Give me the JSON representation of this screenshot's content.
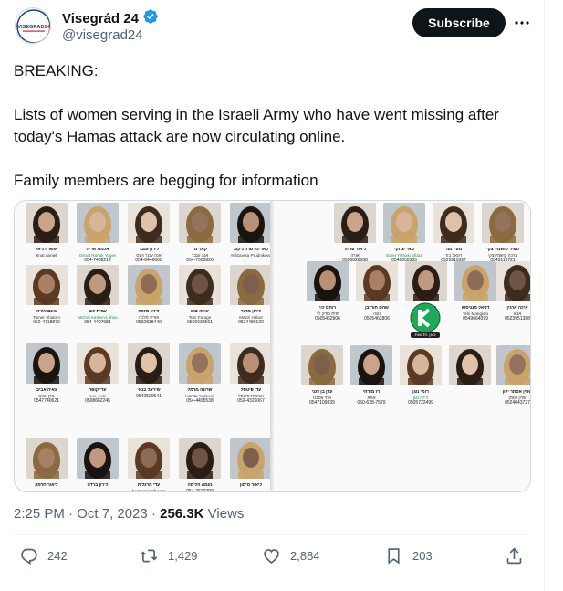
{
  "author": {
    "name": "Visegrád 24",
    "handle": "@visegrad24",
    "avatar_text": "VISEGRAD24"
  },
  "subscribe_label": "Subscribe",
  "tweet": {
    "lines": [
      "BREAKING:",
      "Lists of women serving in the Israeli Army who have went missing after today's Hamas attack are now circulating online.",
      "Family members are begging for information"
    ]
  },
  "media": {
    "watermark": "כאן חדשות",
    "left_page": [
      {
        "name": "אושר דניאל",
        "sub": "rinat daniel",
        "phone": ""
      },
      {
        "name": "אלמוג אריה",
        "sub": "Osnat Rahak Yogev",
        "phone": "054-7488212"
      },
      {
        "name": "לירון ענבר",
        "sub": "אנה עננר ווינס",
        "phone": "054-6446008"
      },
      {
        "name": "קארינה",
        "sub": "אנה ענבר",
        "phone": "054-7565820"
      },
      {
        "name": "קארינה פרודניקוב",
        "sub": "Yelizaveta Prudnikova",
        "phone": ""
      },
      {
        "name": "נועם אליה",
        "sub": "Tomer Shalom",
        "phone": "052-4718870"
      },
      {
        "name": "עמית לוב",
        "sub": "Michal Karben-Lahav",
        "phone": "054-4407981"
      },
      {
        "name": "לירון מלכה",
        "sub": "אורלי מלכה",
        "phone": "0532838440"
      },
      {
        "name": "נועה פרג'",
        "sub": "Tom Farage",
        "phone": "0506633561"
      },
      {
        "name": "לירון מאור",
        "sub": "Mazzi Habut",
        "phone": "0524480122"
      },
      {
        "name": "גאיה אביב",
        "sub": "גורן אביב",
        "phone": "0547740621"
      },
      {
        "name": "עדי קופר",
        "sub": "mor_kobi",
        "phone": "0508662245"
      },
      {
        "name": "שיראל בנאי",
        "sub": "",
        "phone": "0542500541"
      },
      {
        "name": "שרונה מרמל",
        "sub": "Hanita Yudevsil",
        "phone": "054-4495538"
      },
      {
        "name": "עדן פיטסל",
        "sub": "אביבית פיטסל",
        "phone": "052-4326067"
      },
      {
        "name": "ליאור חרמון",
        "sub": "",
        "phone": ""
      },
      {
        "name": "לירון ברדה",
        "sub": "",
        "phone": ""
      },
      {
        "name": "עדי מרגלית",
        "sub": "harmonicsoft.corp",
        "phone": ""
      },
      {
        "name": "נעמה הלימה",
        "sub": "",
        "phone": "054-7600200"
      },
      {
        "name": "ליאור מימון",
        "sub": "",
        "phone": ""
      }
    ],
    "right_page": [
      {
        "name": "ליאור פרחר",
        "sub": "אורה",
        "phone": "0558826588"
      },
      {
        "name": "מאי יצחקי",
        "sub": "Eden Yizhaki Elbaz",
        "phone": "0549850385"
      },
      {
        "name": "מעין מור",
        "sub": "רונאל בור",
        "phone": "0525911897"
      },
      {
        "name": "ספיר קושמירצקי",
        "sub": "ברכה קושמירצקי",
        "phone": "0543118721"
      },
      {
        "name": "רותם לוי",
        "sub": "יפית בודק לוי",
        "phone": "0505462906"
      },
      {
        "name": "שחם חורזבן",
        "sub": "נוגה",
        "phone": "0505462806"
      },
      {
        "name": "ליאור רחל",
        "sub": "Hofit Rahal",
        "phone": "0542335626"
      },
      {
        "name": "דניאל מנגיסטו",
        "sub": "Tehi Mangisto",
        "phone": "0549664099"
      },
      {
        "name": "אילה ארגין",
        "sub": "אבא",
        "phone": "0523951388"
      },
      {
        "name": "עדן בן דגני",
        "sub": "אתי אסבנו",
        "phone": "0547109839"
      },
      {
        "name": "רז מזרחי",
        "sub": "אמא",
        "phone": "050-628-7579"
      },
      {
        "name": "רומי נוגן",
        "sub": "הילה נוגן",
        "phone": "0505722499"
      },
      {
        "name": "",
        "sub": "",
        "phone": ""
      },
      {
        "name": "שטין אסתר ילון",
        "sub": "שרון ויסמן",
        "phone": "0524043727"
      }
    ]
  },
  "meta": {
    "time": "2:25 PM",
    "date": "Oct 7, 2023",
    "views_count": "256.3K",
    "views_label": "Views"
  },
  "actions": {
    "replies": "242",
    "reposts": "1,429",
    "likes": "2,884",
    "bookmarks": "203"
  },
  "colors": {
    "text": "#0f1419",
    "muted": "#536471",
    "border": "#cfd9de",
    "verified": "#1d9bf0",
    "brand_red": "#d9232e",
    "brand_blue": "#1c3f93",
    "watermark_green": "#1faa59"
  }
}
